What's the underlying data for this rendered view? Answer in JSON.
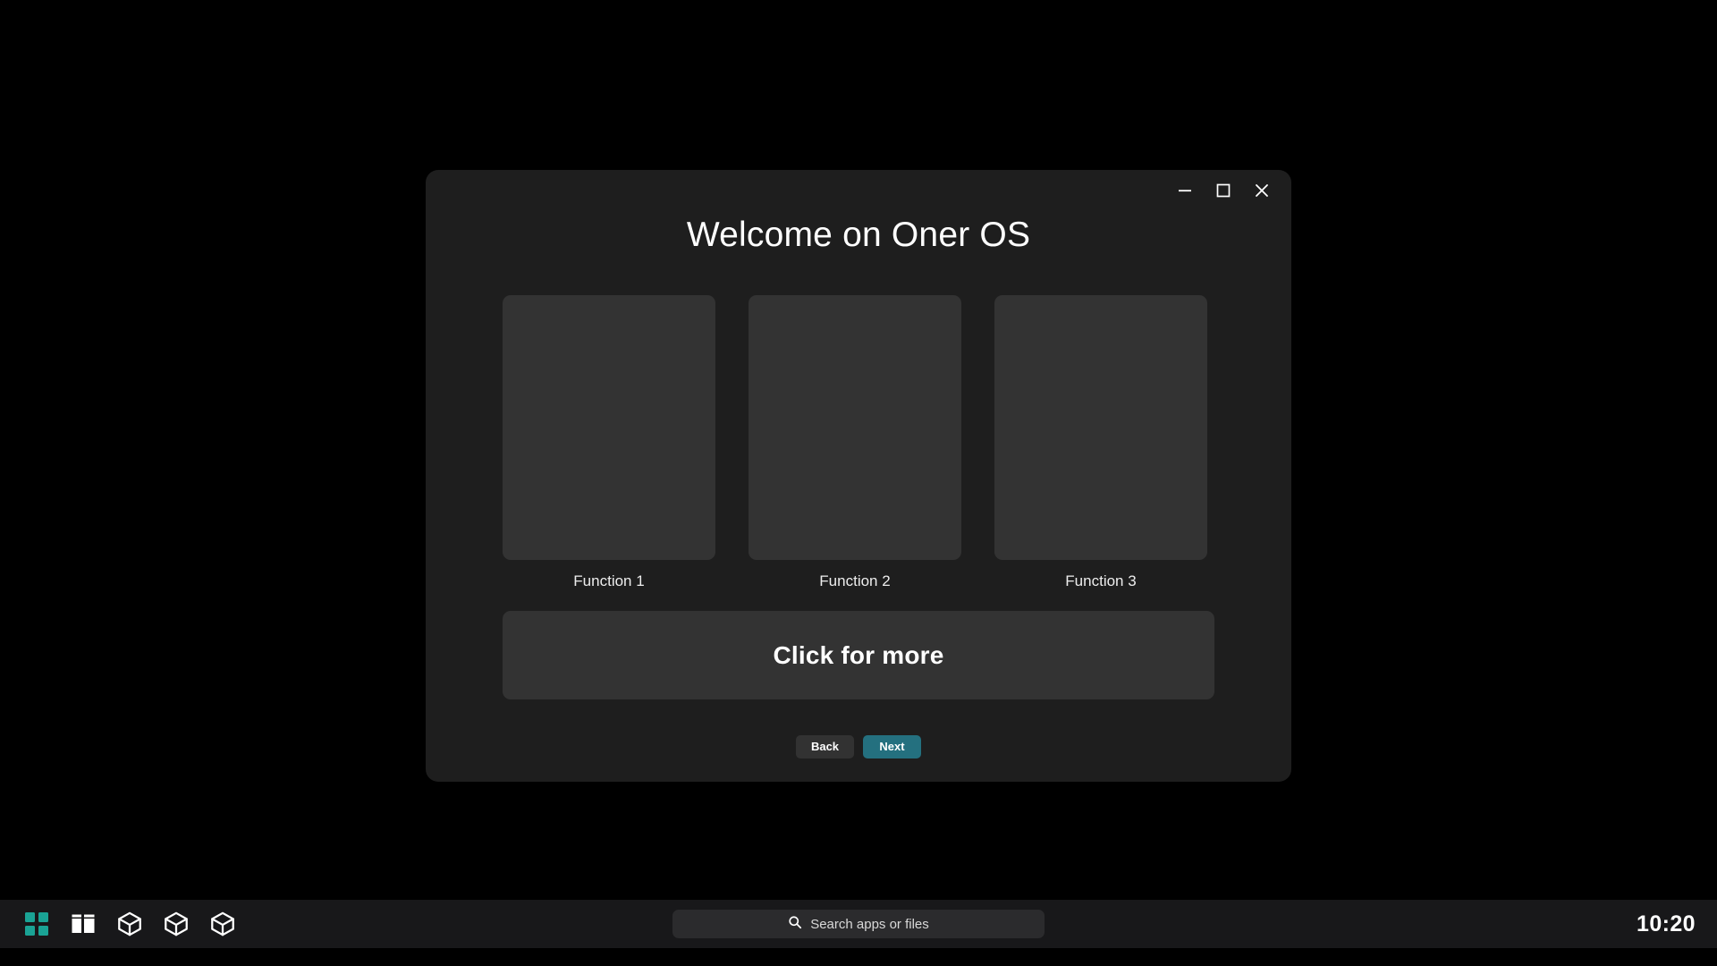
{
  "window": {
    "title": "Welcome on Oner OS",
    "controls": [
      {
        "name": "minimize",
        "label": "Minimize",
        "glyph": "minimize-icon"
      },
      {
        "name": "maximize",
        "label": "Maximize",
        "glyph": "maximize-icon"
      },
      {
        "name": "close",
        "label": "Close",
        "glyph": "close-icon"
      }
    ],
    "cards": [
      {
        "label": "Function 1"
      },
      {
        "label": "Function 2"
      },
      {
        "label": "Function 3"
      }
    ],
    "more_panel": {
      "label": "Click for more"
    },
    "footer": {
      "back_label": "Back",
      "next_label": "Next"
    }
  },
  "taskbar": {
    "icons": [
      {
        "name": "app-launcher-icon",
        "title": "Apps"
      },
      {
        "name": "window-panels-icon",
        "title": "Windows"
      },
      {
        "name": "cube-icon-1",
        "title": "App"
      },
      {
        "name": "cube-icon-2",
        "title": "App"
      },
      {
        "name": "cube-icon-3",
        "title": "App"
      }
    ],
    "search": {
      "placeholder": "Search apps or files",
      "value": ""
    },
    "clock": "10:20"
  },
  "colors": {
    "desktop_bg": "#000000",
    "window_bg": "#1e1e1e",
    "card_bg": "#333333",
    "taskbar_bg": "#18181a",
    "accent_teal": "#24707f",
    "launcher_teal": "#1aa395",
    "text_primary": "#ffffff"
  }
}
